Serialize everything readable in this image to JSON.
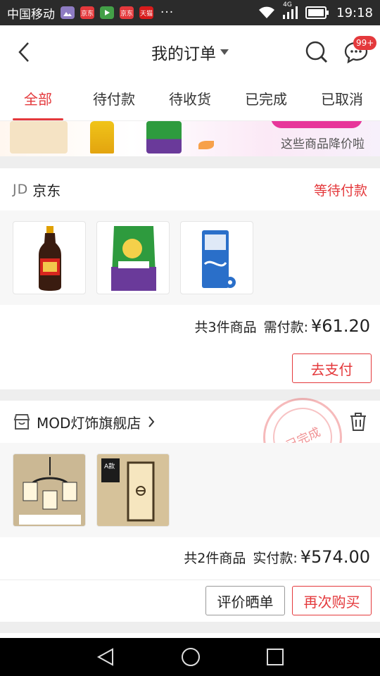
{
  "status_bar": {
    "carrier": "中国移动",
    "apps": [
      {
        "icon": "gallery-icon",
        "color": "#8e7cc3"
      },
      {
        "icon": "jd-app-icon",
        "color": "#e4393c",
        "text": "京东"
      },
      {
        "icon": "play-icon",
        "color": "#43a047"
      },
      {
        "icon": "jd-app-icon-2",
        "color": "#e4393c",
        "text": "京东"
      },
      {
        "icon": "tmall-icon",
        "color": "#d81b1b",
        "text": "天猫"
      }
    ],
    "more": "···",
    "network": "4G",
    "time": "19:18"
  },
  "header": {
    "title": "我的订单",
    "message_badge": "99+"
  },
  "tabs": [
    {
      "label": "全部",
      "active": true
    },
    {
      "label": "待付款"
    },
    {
      "label": "待收货"
    },
    {
      "label": "已完成"
    },
    {
      "label": "已取消"
    }
  ],
  "promo": {
    "text": "这些商品降价啦"
  },
  "orders": [
    {
      "shop_logo": "JD",
      "shop_name": "京东",
      "status": "等待付款",
      "items": [
        "soy-sauce",
        "rice-bag",
        "tissue-pack"
      ],
      "count_text": "共3件商品",
      "pay_label": "需付款:",
      "price": "¥61.20",
      "buttons": [
        "去支付"
      ]
    },
    {
      "shop_name": "MOD灯饰旗舰店",
      "stamp": "已完成",
      "items": [
        "chandelier",
        "wall-lamp"
      ],
      "item_labels": [
        "A款"
      ],
      "count_text": "共2件商品",
      "pay_label": "实付款:",
      "price": "¥574.00",
      "buttons": [
        "评价晒单",
        "再次购买"
      ]
    }
  ],
  "colors": {
    "accent": "#e4393c",
    "background": "#eeeeee"
  }
}
